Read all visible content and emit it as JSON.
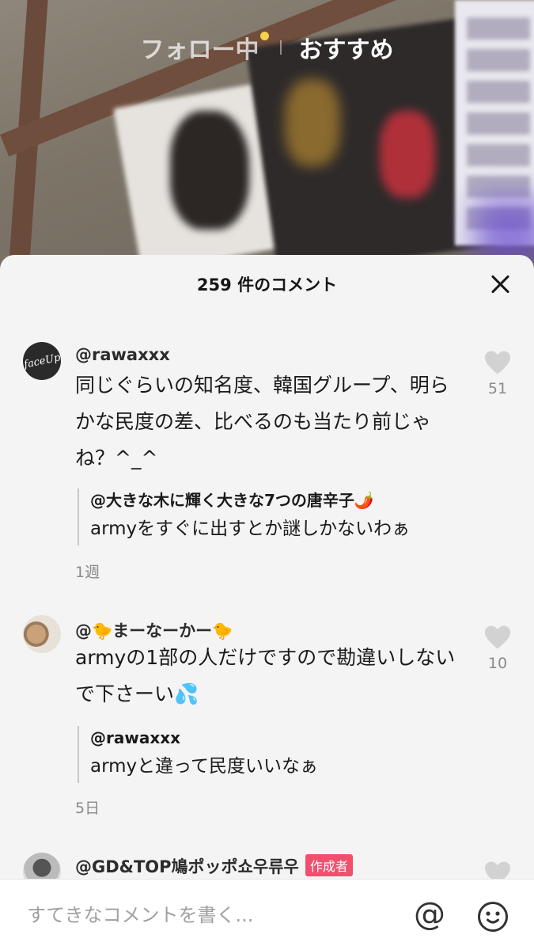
{
  "top_tabs": {
    "following": "フォロー中",
    "recommended": "おすすめ"
  },
  "colors": {
    "accent_badge": "#f0506e",
    "notification_dot": "#f7d148",
    "sheet_bg": "#f4f4f4"
  },
  "comments_sheet": {
    "title": "259 件のコメント",
    "comments": [
      {
        "username": "@rawaxxx",
        "avatar_text": "faceUp",
        "text": "同じぐらいの知名度、韓国グループ、明らかな民度の差、比べるのも当たり前じゃね？^_^",
        "reply": {
          "username": "@大きな木に輝く大きな7つの唐辛子🌶️",
          "text": "armyをすぐに出すとか謎しかないわぁ"
        },
        "time": "1週",
        "likes": "51"
      },
      {
        "username": "@🐤まーなーかー🐤",
        "text": "armyの1部の人だけですので勘違いしないで下さーい💦",
        "reply": {
          "username": "@rawaxxx",
          "text": "armyと違って民度いいなぁ"
        },
        "time": "5日",
        "likes": "10"
      },
      {
        "username": "@GD&TOP鳩ポッポ쇼우류우",
        "badge": "作成者"
      }
    ]
  },
  "input_bar": {
    "placeholder": "すてきなコメントを書く...",
    "mention_label": "@"
  },
  "icons": [
    "close-icon",
    "heart-icon",
    "at-icon",
    "emoji-icon"
  ]
}
